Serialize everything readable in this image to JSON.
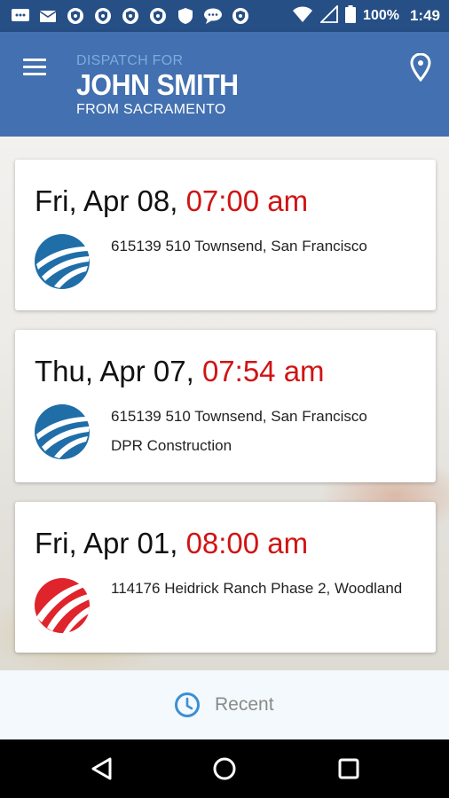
{
  "status_bar": {
    "battery_percent": "100%",
    "time": "1:49",
    "left_icons": [
      "chat-icon",
      "mail-icon",
      "shield-notification-icon",
      "shield-notification-icon",
      "shield-notification-icon",
      "shield-notification-icon",
      "shield-icon",
      "message-icon",
      "shield-notification-icon"
    ],
    "right_icons": [
      "wifi-icon",
      "signal-icon",
      "battery-icon"
    ]
  },
  "header": {
    "dispatch_for_label": "DISPATCH FOR",
    "driver_name": "JOHN SMITH",
    "from_label": "FROM SACRAMENTO",
    "background_color": "#4270b0",
    "subtitle_color": "#7fa9e0"
  },
  "dispatches": [
    {
      "date": "Fri, Apr 08,",
      "time": "07:00 am",
      "logo": "blue-company-logo",
      "lines": [
        "615139 510 Townsend, San Francisco"
      ]
    },
    {
      "date": "Thu, Apr 07,",
      "time": "07:54 am",
      "logo": "blue-company-logo",
      "lines": [
        "615139 510 Townsend, San Francisco",
        "DPR Construction"
      ]
    },
    {
      "date": "Fri, Apr 01,",
      "time": "08:00 am",
      "logo": "red-company-logo",
      "lines": [
        "114176 Heidrick Ranch Phase 2, Woodland"
      ]
    }
  ],
  "colors": {
    "time_accent": "#d01414",
    "logo_blue": "#1f6ea8",
    "logo_red": "#e0242b"
  },
  "bottom_bar": {
    "recent_label": "Recent",
    "recent_icon": "clock-icon"
  },
  "nav_bar": {
    "icons": [
      "back-icon",
      "home-icon",
      "recents-icon"
    ]
  }
}
